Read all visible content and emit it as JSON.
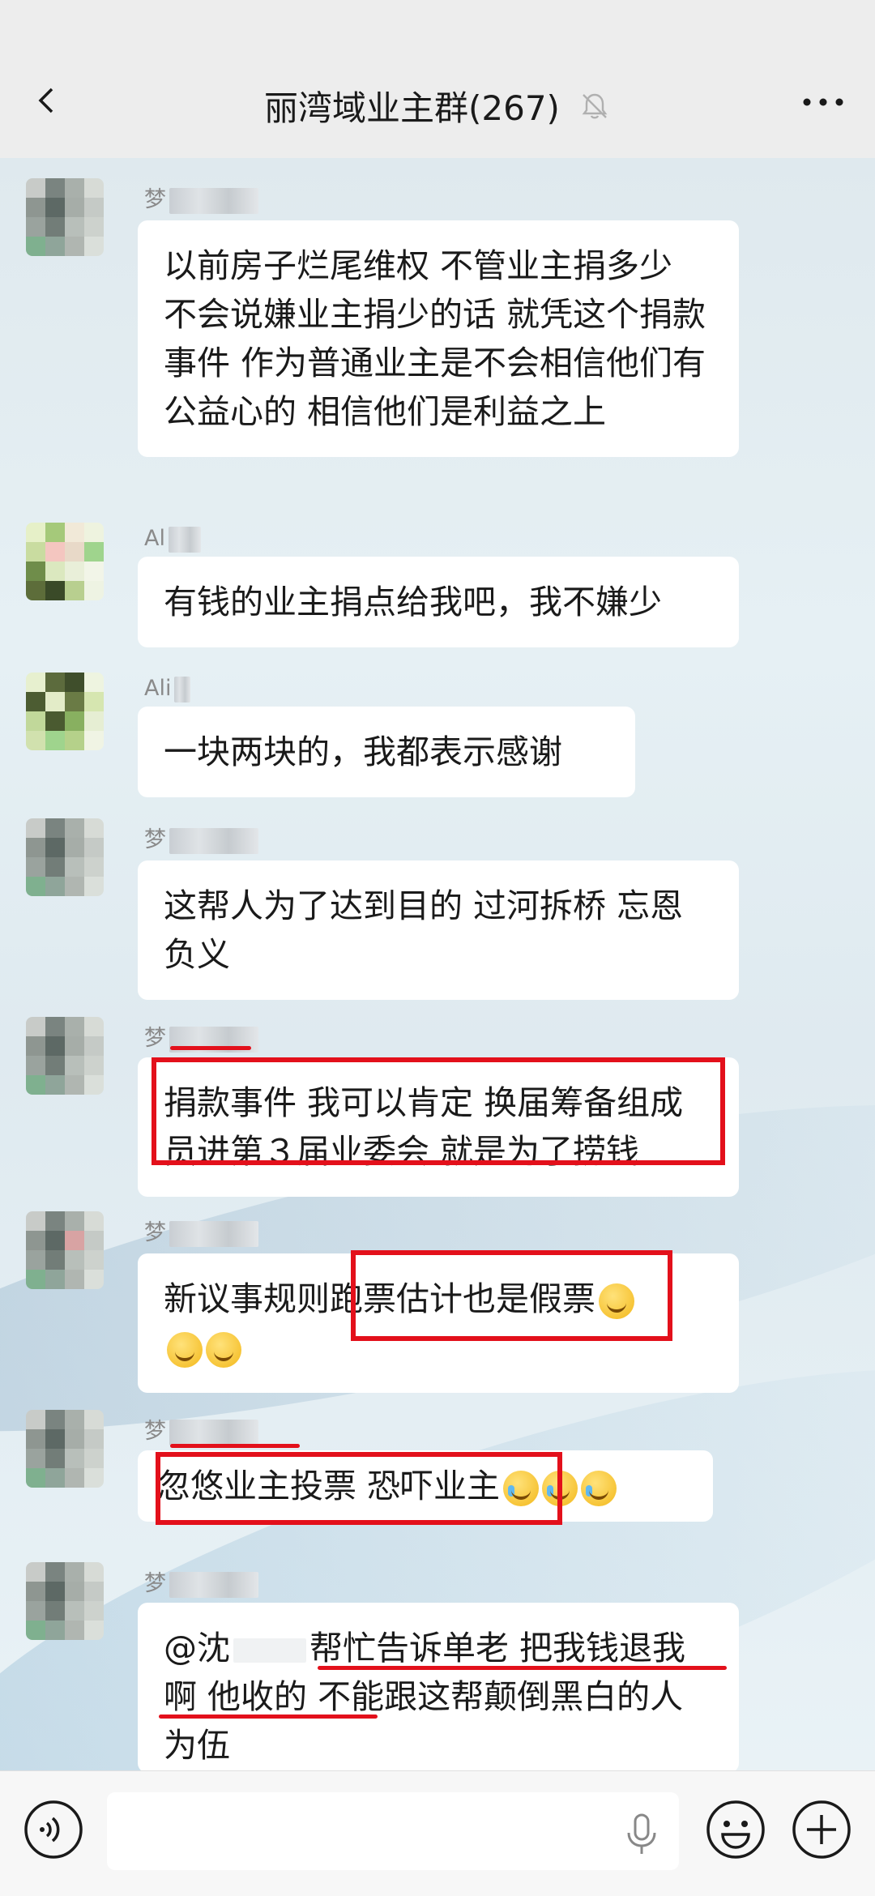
{
  "header": {
    "title": "丽湾域业主群(267)",
    "back_icon": "chevron-left-icon",
    "mute_icon": "bell-muted-icon",
    "more_icon": "more-dots-icon"
  },
  "messages": [
    {
      "sender": "梦",
      "text": "以前房子烂尾维权  不管业主捐多少  不会说嫌业主捐少的话  就凭这个捐款事件  作为普通业主是不会相信他们有公益心的  相信他们是利益之上"
    },
    {
      "sender": "Al",
      "text": "有钱的业主捐点给我吧，我不嫌少"
    },
    {
      "sender": "Ali",
      "text": "一块两块的，我都表示感谢"
    },
    {
      "sender": "梦",
      "text": "这帮人为了达到目的  过河拆桥 忘恩负义"
    },
    {
      "sender": "梦",
      "text": "捐款事件  我可以肯定  换届筹备组成员进第３届业委会 就是为了捞钱"
    },
    {
      "sender": "梦",
      "text_a": "新议事规则",
      "text_b": "跑票估计也是假票",
      "emoji": "thinking-face-icon"
    },
    {
      "sender": "梦",
      "text": "忽悠业主投票  恐吓业主",
      "emoji": "laughing-crying-icon"
    },
    {
      "sender": "梦",
      "mention": "@沈",
      "text_a": "帮忙告诉单老  把我钱退我啊  他收的",
      "text_b": " 不能跟这帮颠倒黑白的人为伍"
    }
  ],
  "input": {
    "voice_icon": "voice-icon",
    "mic_icon": "microphone-icon",
    "emoji_icon": "emoji-icon",
    "plus_icon": "plus-icon"
  },
  "colors": {
    "header_bg": "#ededed",
    "bubble_bg": "#ffffff",
    "highlight_red": "#e3101b"
  }
}
